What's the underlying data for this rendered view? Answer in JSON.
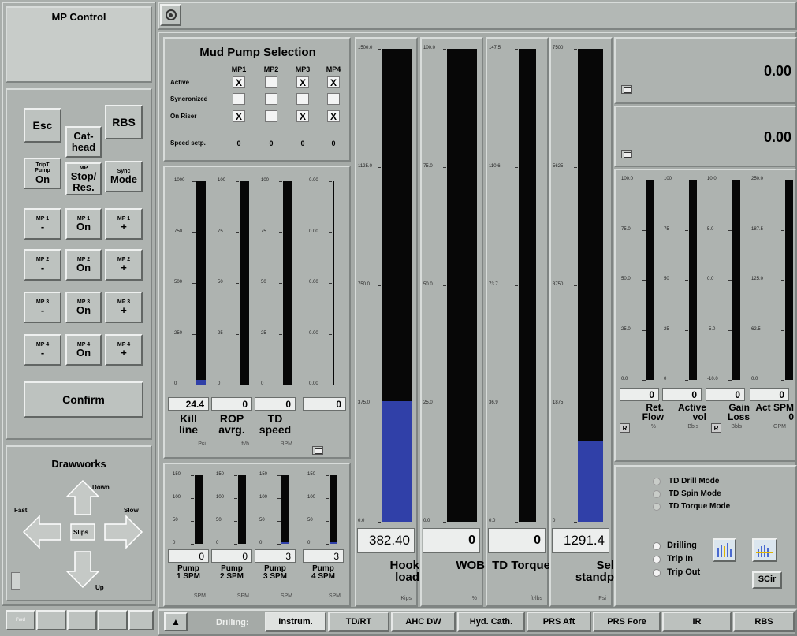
{
  "left": {
    "title": "MP Control",
    "buttons": {
      "esc": "Esc",
      "rbs": "RBS",
      "cathead": [
        "Cat-",
        "head"
      ],
      "trip_pump": [
        "TripT",
        "Pump",
        "On"
      ],
      "mp_stop": [
        "MP",
        "Stop/",
        "Res."
      ],
      "sync": [
        "Sync",
        "Mode"
      ],
      "mp_rows": [
        [
          [
            "MP 1",
            "-"
          ],
          [
            "MP 1",
            "On"
          ],
          [
            "MP 1",
            "+"
          ]
        ],
        [
          [
            "MP 2",
            "-"
          ],
          [
            "MP 2",
            "On"
          ],
          [
            "MP 2",
            "+"
          ]
        ],
        [
          [
            "MP 3",
            "-"
          ],
          [
            "MP 3",
            "On"
          ],
          [
            "MP 3",
            "+"
          ]
        ],
        [
          [
            "MP 4",
            "-"
          ],
          [
            "MP 4",
            "On"
          ],
          [
            "MP 4",
            "+"
          ]
        ]
      ],
      "confirm": "Confirm"
    },
    "drawworks": {
      "title": "Drawworks",
      "down": "Down",
      "fast": "Fast",
      "slow": "Slow",
      "slips": "Slips",
      "up": "Up"
    },
    "bottom_btn": "Fwd"
  },
  "mud_pump": {
    "title": "Mud Pump Selection",
    "cols": [
      "MP1",
      "MP2",
      "MP3",
      "MP4"
    ],
    "rows": [
      {
        "label": "Active",
        "vals": [
          "X",
          "",
          "X",
          "X"
        ]
      },
      {
        "label": "Syncronized",
        "vals": [
          "",
          "",
          "",
          ""
        ]
      },
      {
        "label": "On Riser",
        "vals": [
          "X",
          "",
          "X",
          "X"
        ]
      }
    ],
    "speed_label": "Speed setp.",
    "speed_vals": [
      "0",
      "0",
      "0",
      "0"
    ]
  },
  "small_gauges": [
    {
      "ticks": [
        "1000",
        "750",
        "500",
        "250",
        "0"
      ],
      "value": "24.4",
      "label": [
        "Kill",
        "line"
      ],
      "unit": "Psi",
      "fill": 0.024
    },
    {
      "ticks": [
        "100",
        "75",
        "50",
        "25",
        "0"
      ],
      "value": "0",
      "label": [
        "ROP",
        "avrg."
      ],
      "unit": "ft/h",
      "fill": 0
    },
    {
      "ticks": [
        "100",
        "75",
        "50",
        "25",
        "0"
      ],
      "value": "0",
      "label": [
        "TD",
        "speed"
      ],
      "unit": "RPM",
      "fill": 0
    },
    {
      "ticks": [
        "0.00",
        "0.00",
        "0.00",
        "0.00",
        "0.00"
      ],
      "value": "0",
      "label": [
        "",
        ""
      ],
      "unit": "",
      "fill": 0
    }
  ],
  "pump_gauges": [
    {
      "ticks": [
        "150",
        "100",
        "50",
        "0"
      ],
      "value": "0",
      "label": [
        "Pump",
        "1 SPM"
      ],
      "unit": "SPM",
      "fill": 0
    },
    {
      "ticks": [
        "150",
        "100",
        "50",
        "0"
      ],
      "value": "0",
      "label": [
        "Pump",
        "2 SPM"
      ],
      "unit": "SPM",
      "fill": 0
    },
    {
      "ticks": [
        "150",
        "100",
        "50",
        "0"
      ],
      "value": "3",
      "label": [
        "Pump",
        "3 SPM"
      ],
      "unit": "SPM",
      "fill": 0.02
    },
    {
      "ticks": [
        "150",
        "100",
        "50",
        "0"
      ],
      "value": "3",
      "label": [
        "Pump",
        "4 SPM"
      ],
      "unit": "SPM",
      "fill": 0.02
    }
  ],
  "big_gauges": [
    {
      "ticks": [
        "1500.0",
        "1125.0",
        "750.0",
        "375.0",
        "0.0"
      ],
      "value": "382.40",
      "label": [
        "Hook",
        "load"
      ],
      "unit": "Kips",
      "fill": 0.255
    },
    {
      "ticks": [
        "100.0",
        "75.0",
        "50.0",
        "25.0",
        "0.0"
      ],
      "value": "0",
      "label": [
        "WOB",
        ""
      ],
      "unit": "%",
      "fill": 0
    },
    {
      "ticks": [
        "147.5",
        "110.6",
        "73.7",
        "36.9",
        "0.0"
      ],
      "value": "0",
      "label": [
        "TD Torque",
        ""
      ],
      "unit": "ft-lbs",
      "fill": 0
    },
    {
      "ticks": [
        "7500",
        "5625",
        "3750",
        "1875",
        "0"
      ],
      "value": "1291.4",
      "label": [
        "Sel",
        "standp"
      ],
      "unit": "Psi",
      "fill": 0.172
    }
  ],
  "readouts": [
    "0.00",
    "0.00"
  ],
  "right_gauges": [
    {
      "ticks": [
        "100.0",
        "75.0",
        "50.0",
        "25.0",
        "0.0"
      ],
      "value": "0",
      "label": [
        "Ret.",
        "Flow"
      ],
      "unit": "%",
      "fill": 0
    },
    {
      "ticks": [
        "100",
        "75",
        "50",
        "25",
        "0"
      ],
      "value": "0",
      "label": [
        "Active",
        "vol"
      ],
      "unit": "Bbls",
      "fill": 0
    },
    {
      "ticks": [
        "10.0",
        "5.0",
        "0.0",
        "-5.0",
        "-10.0"
      ],
      "value": "0",
      "label": [
        "Gain",
        "Loss"
      ],
      "unit": "Bbls",
      "fill": 0
    },
    {
      "ticks": [
        "250.0",
        "187.5",
        "125.0",
        "62.5",
        "0.0"
      ],
      "value": "0",
      "label": [
        "Act SPM",
        "0"
      ],
      "unit": "GPM",
      "fill": 0
    }
  ],
  "td_modes": [
    "TD Drill Mode",
    "TD Spin Mode",
    "TD Torque Mode"
  ],
  "drill_modes": [
    "Drilling",
    "Trip In",
    "Trip Out"
  ],
  "scir": "SCir",
  "r_label": "R",
  "tabs": {
    "group": "Drilling:",
    "items": [
      "Instrum.",
      "TD/RT",
      "AHC DW",
      "Hyd. Cath.",
      "PRS Aft",
      "PRS Fore",
      "IR",
      "RBS"
    ]
  }
}
